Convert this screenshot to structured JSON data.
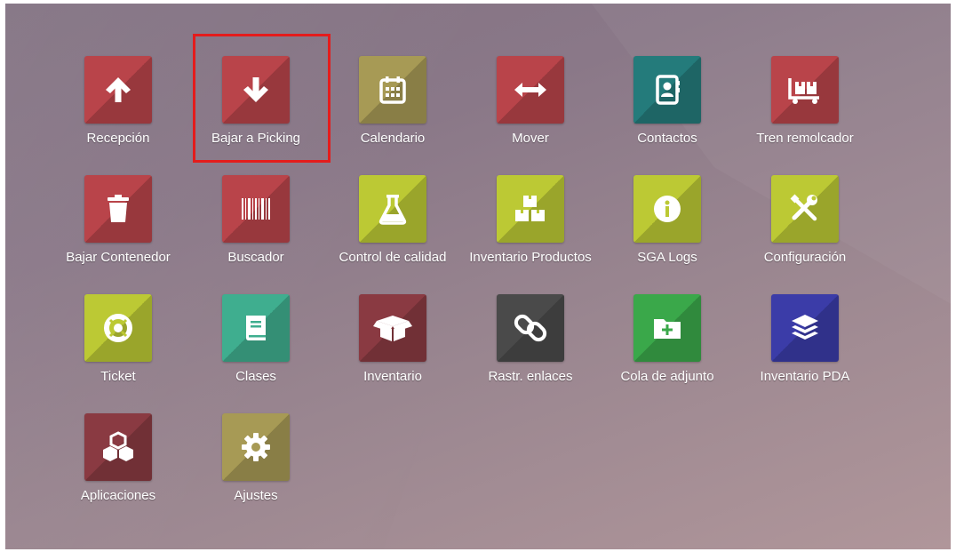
{
  "apps": [
    {
      "label": "Recepción",
      "icon": "arrow-up-icon",
      "color": "#b9444a"
    },
    {
      "label": "Bajar a Picking",
      "icon": "arrow-down-icon",
      "color": "#b9444a"
    },
    {
      "label": "Calendario",
      "icon": "calendar-icon",
      "color": "#a79a55"
    },
    {
      "label": "Mover",
      "icon": "arrows-horizontal-icon",
      "color": "#b9444a"
    },
    {
      "label": "Contactos",
      "icon": "address-book-icon",
      "color": "#247b7b"
    },
    {
      "label": "Tren remolcador",
      "icon": "trolley-icon",
      "color": "#b9444a"
    },
    {
      "label": "Bajar Contenedor",
      "icon": "trash-icon",
      "color": "#b9444a"
    },
    {
      "label": "Buscador",
      "icon": "barcode-icon",
      "color": "#b9444a"
    },
    {
      "label": "Control de calidad",
      "icon": "flask-icon",
      "color": "#bcc934"
    },
    {
      "label": "Inventario Productos",
      "icon": "boxes-icon",
      "color": "#bcc934"
    },
    {
      "label": "SGA Logs",
      "icon": "info-icon",
      "color": "#bcc934"
    },
    {
      "label": "Configuración",
      "icon": "tools-icon",
      "color": "#bcc934"
    },
    {
      "label": "Ticket",
      "icon": "life-ring-icon",
      "color": "#bcc934"
    },
    {
      "label": "Clases",
      "icon": "book-icon",
      "color": "#3fae8f"
    },
    {
      "label": "Inventario",
      "icon": "open-box-icon",
      "color": "#8a3a42"
    },
    {
      "label": "Rastr. enlaces",
      "icon": "link-icon",
      "color": "#4a4a4a"
    },
    {
      "label": "Cola de adjunto",
      "icon": "folder-plus-icon",
      "color": "#3aa84a"
    },
    {
      "label": "Inventario PDA",
      "icon": "layers-icon",
      "color": "#3b3ca8"
    },
    {
      "label": "Aplicaciones",
      "icon": "cubes-icon",
      "color": "#8a3a42"
    },
    {
      "label": "Ajustes",
      "icon": "gear-icon",
      "color": "#a79a55"
    }
  ],
  "highlight_color": "#e41c1c"
}
